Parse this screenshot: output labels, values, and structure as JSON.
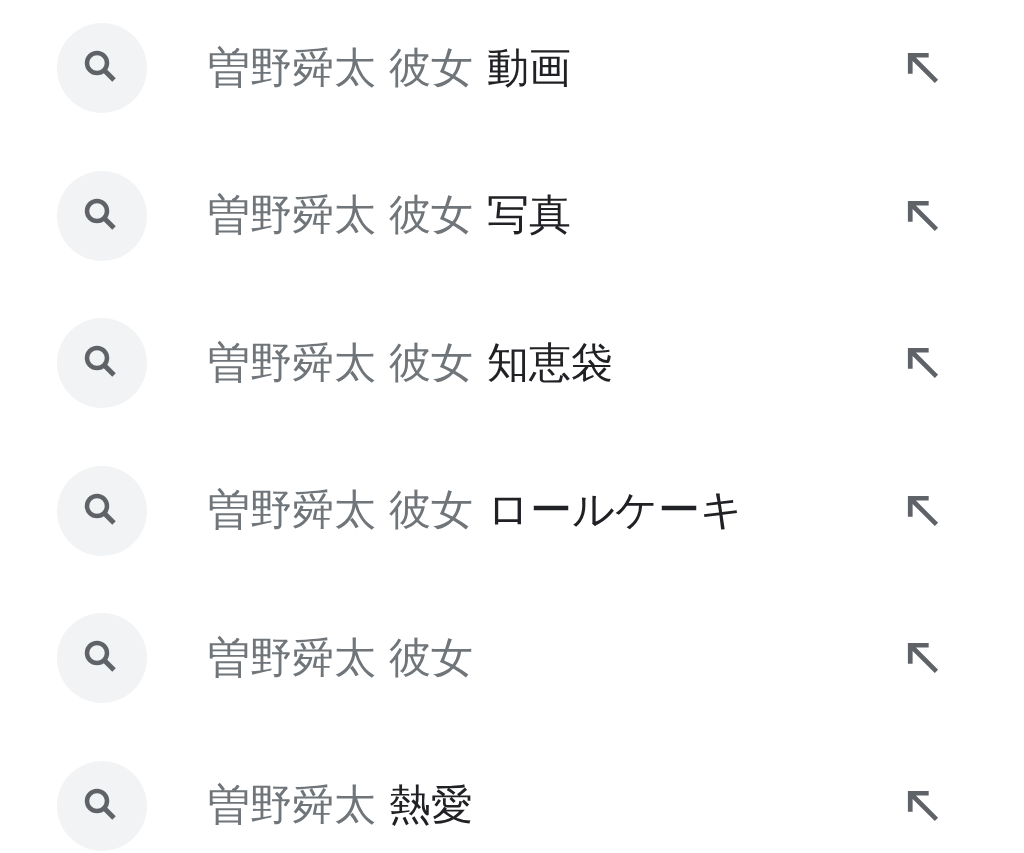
{
  "suggestions": [
    {
      "query": "曽野舜太 彼女",
      "completion": "動画"
    },
    {
      "query": "曽野舜太 彼女",
      "completion": "写真"
    },
    {
      "query": "曽野舜太 彼女",
      "completion": "知恵袋"
    },
    {
      "query": "曽野舜太 彼女",
      "completion": "ロールケーキ"
    },
    {
      "query": "曽野舜太 彼女"
    },
    {
      "query": "曽野舜太",
      "completion": "熱愛"
    }
  ]
}
